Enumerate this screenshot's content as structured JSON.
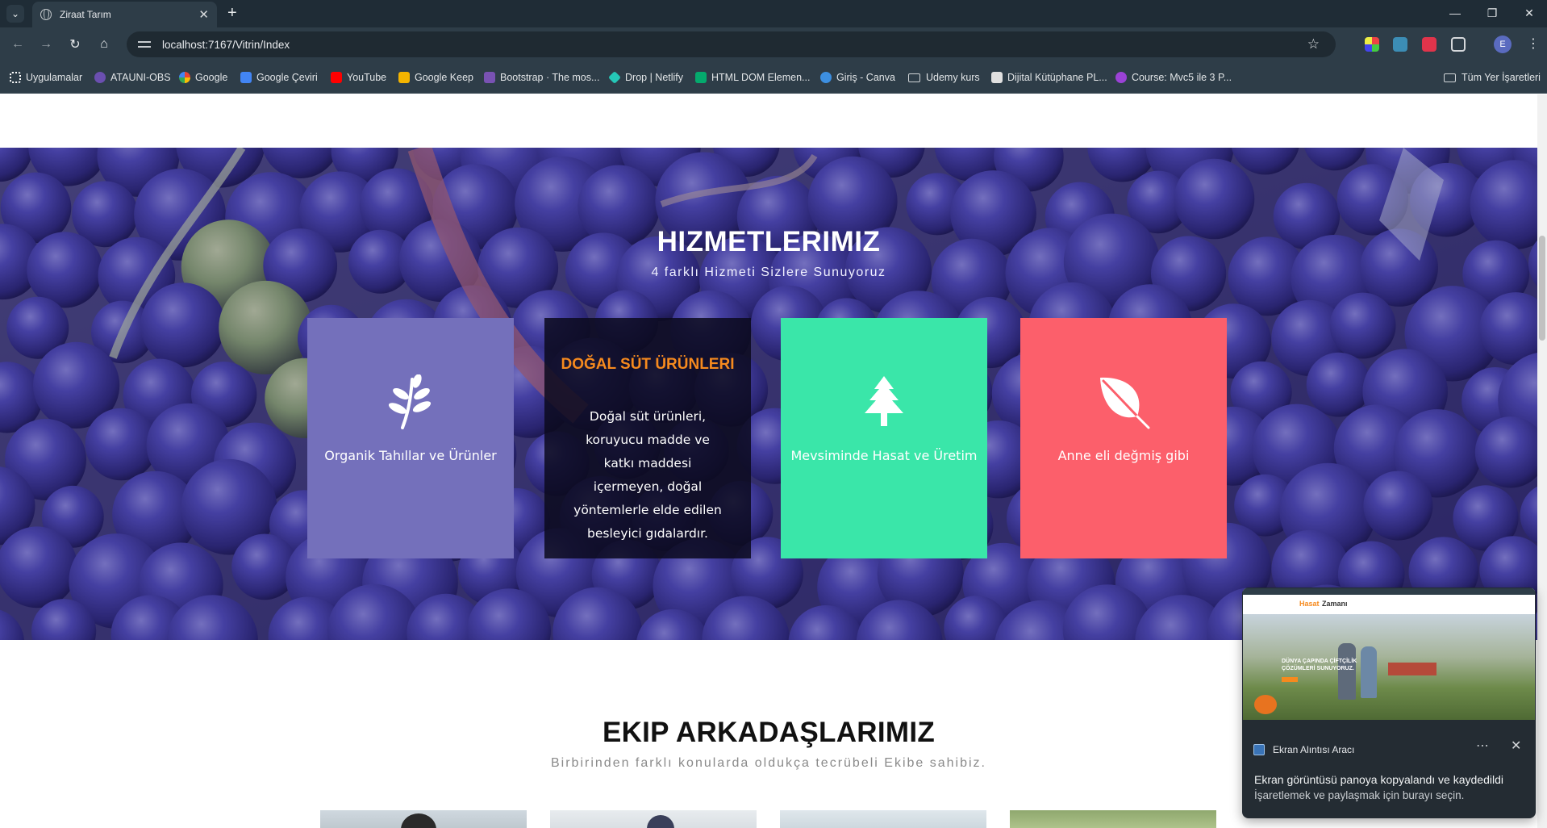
{
  "browser": {
    "tab_title": "Ziraat Tarım",
    "new_tab": "+",
    "url": "localhost:7167/Vitrin/Index",
    "profile_initial": "E"
  },
  "bookmarks": [
    {
      "label": "Uygulamalar",
      "icon": "apps-grid-icon",
      "color": "#ffffff"
    },
    {
      "label": "ATAUNI-OBS",
      "icon": "atauni-icon",
      "color": "#6b4fb0"
    },
    {
      "label": "Google",
      "icon": "google-icon",
      "color": "#4285f4"
    },
    {
      "label": "Google Çeviri",
      "icon": "translate-icon",
      "color": "#4285f4"
    },
    {
      "label": "YouTube",
      "icon": "youtube-icon",
      "color": "#ff0000"
    },
    {
      "label": "Google Keep",
      "icon": "keep-icon",
      "color": "#f4b400"
    },
    {
      "label": "Bootstrap · The mos...",
      "icon": "bootstrap-icon",
      "color": "#7952b3"
    },
    {
      "label": "Drop | Netlify",
      "icon": "netlify-icon",
      "color": "#25c7b7"
    },
    {
      "label": "HTML DOM Elemen...",
      "icon": "w3schools-icon",
      "color": "#04aa6d"
    },
    {
      "label": "Giriş - Canva",
      "icon": "canva-icon",
      "color": "#3d8fe0"
    },
    {
      "label": "Udemy kurs",
      "icon": "folder-icon",
      "color": "#d0d4d7"
    },
    {
      "label": "Dijital Kütüphane PL...",
      "icon": "document-icon",
      "color": "#e0e0e0"
    },
    {
      "label": "Course: Mvc5 ile 3 P...",
      "icon": "course-icon",
      "color": "#9b42d6"
    }
  ],
  "bookmarks_all": "Tüm Yer İşaretleri",
  "services": {
    "title": "HIZMETLERIMIZ",
    "subtitle": "4 farklı Hizmeti Sizlere Sunuyoruz",
    "cards": [
      {
        "label": "Organik Tahıllar ve Ürünler",
        "icon": "sprout-icon",
        "color": "#7470bb"
      },
      {
        "title": "DOĞAL SÜT ÜRÜNLERI",
        "description": "Doğal süt ürünleri, koruyucu madde ve katkı maddesi içermeyen, doğal yöntemlerle elde edilen besleyici gıdalardır.",
        "color": "#15142b"
      },
      {
        "label": "Mevsiminde Hasat ve Üretim",
        "icon": "pine-tree-icon",
        "color": "#3ae6a9"
      },
      {
        "label": "Anne eli değmiş gibi",
        "icon": "leaf-icon",
        "color": "#fc5f6b"
      }
    ]
  },
  "team": {
    "title": "EKIP ARKADAŞLARIMIZ",
    "subtitle": "Birbirinden farklı konularda oldukça tecrübeli Ekibe sahibiz."
  },
  "snip": {
    "app_name": "Ekran Alıntısı Aracı",
    "line1": "Ekran görüntüsü panoya kopyalandı ve kaydedildi",
    "line2": "İşaretlemek ve paylaşmak için burayı seçin.",
    "preview_brand_a": "Hasat",
    "preview_brand_b": "Zamanı",
    "preview_headline": "DÜNYA ÇAPINDA ÇİFTÇİLİK ÇÖZÜMLERİ SUNUYORUZ."
  }
}
